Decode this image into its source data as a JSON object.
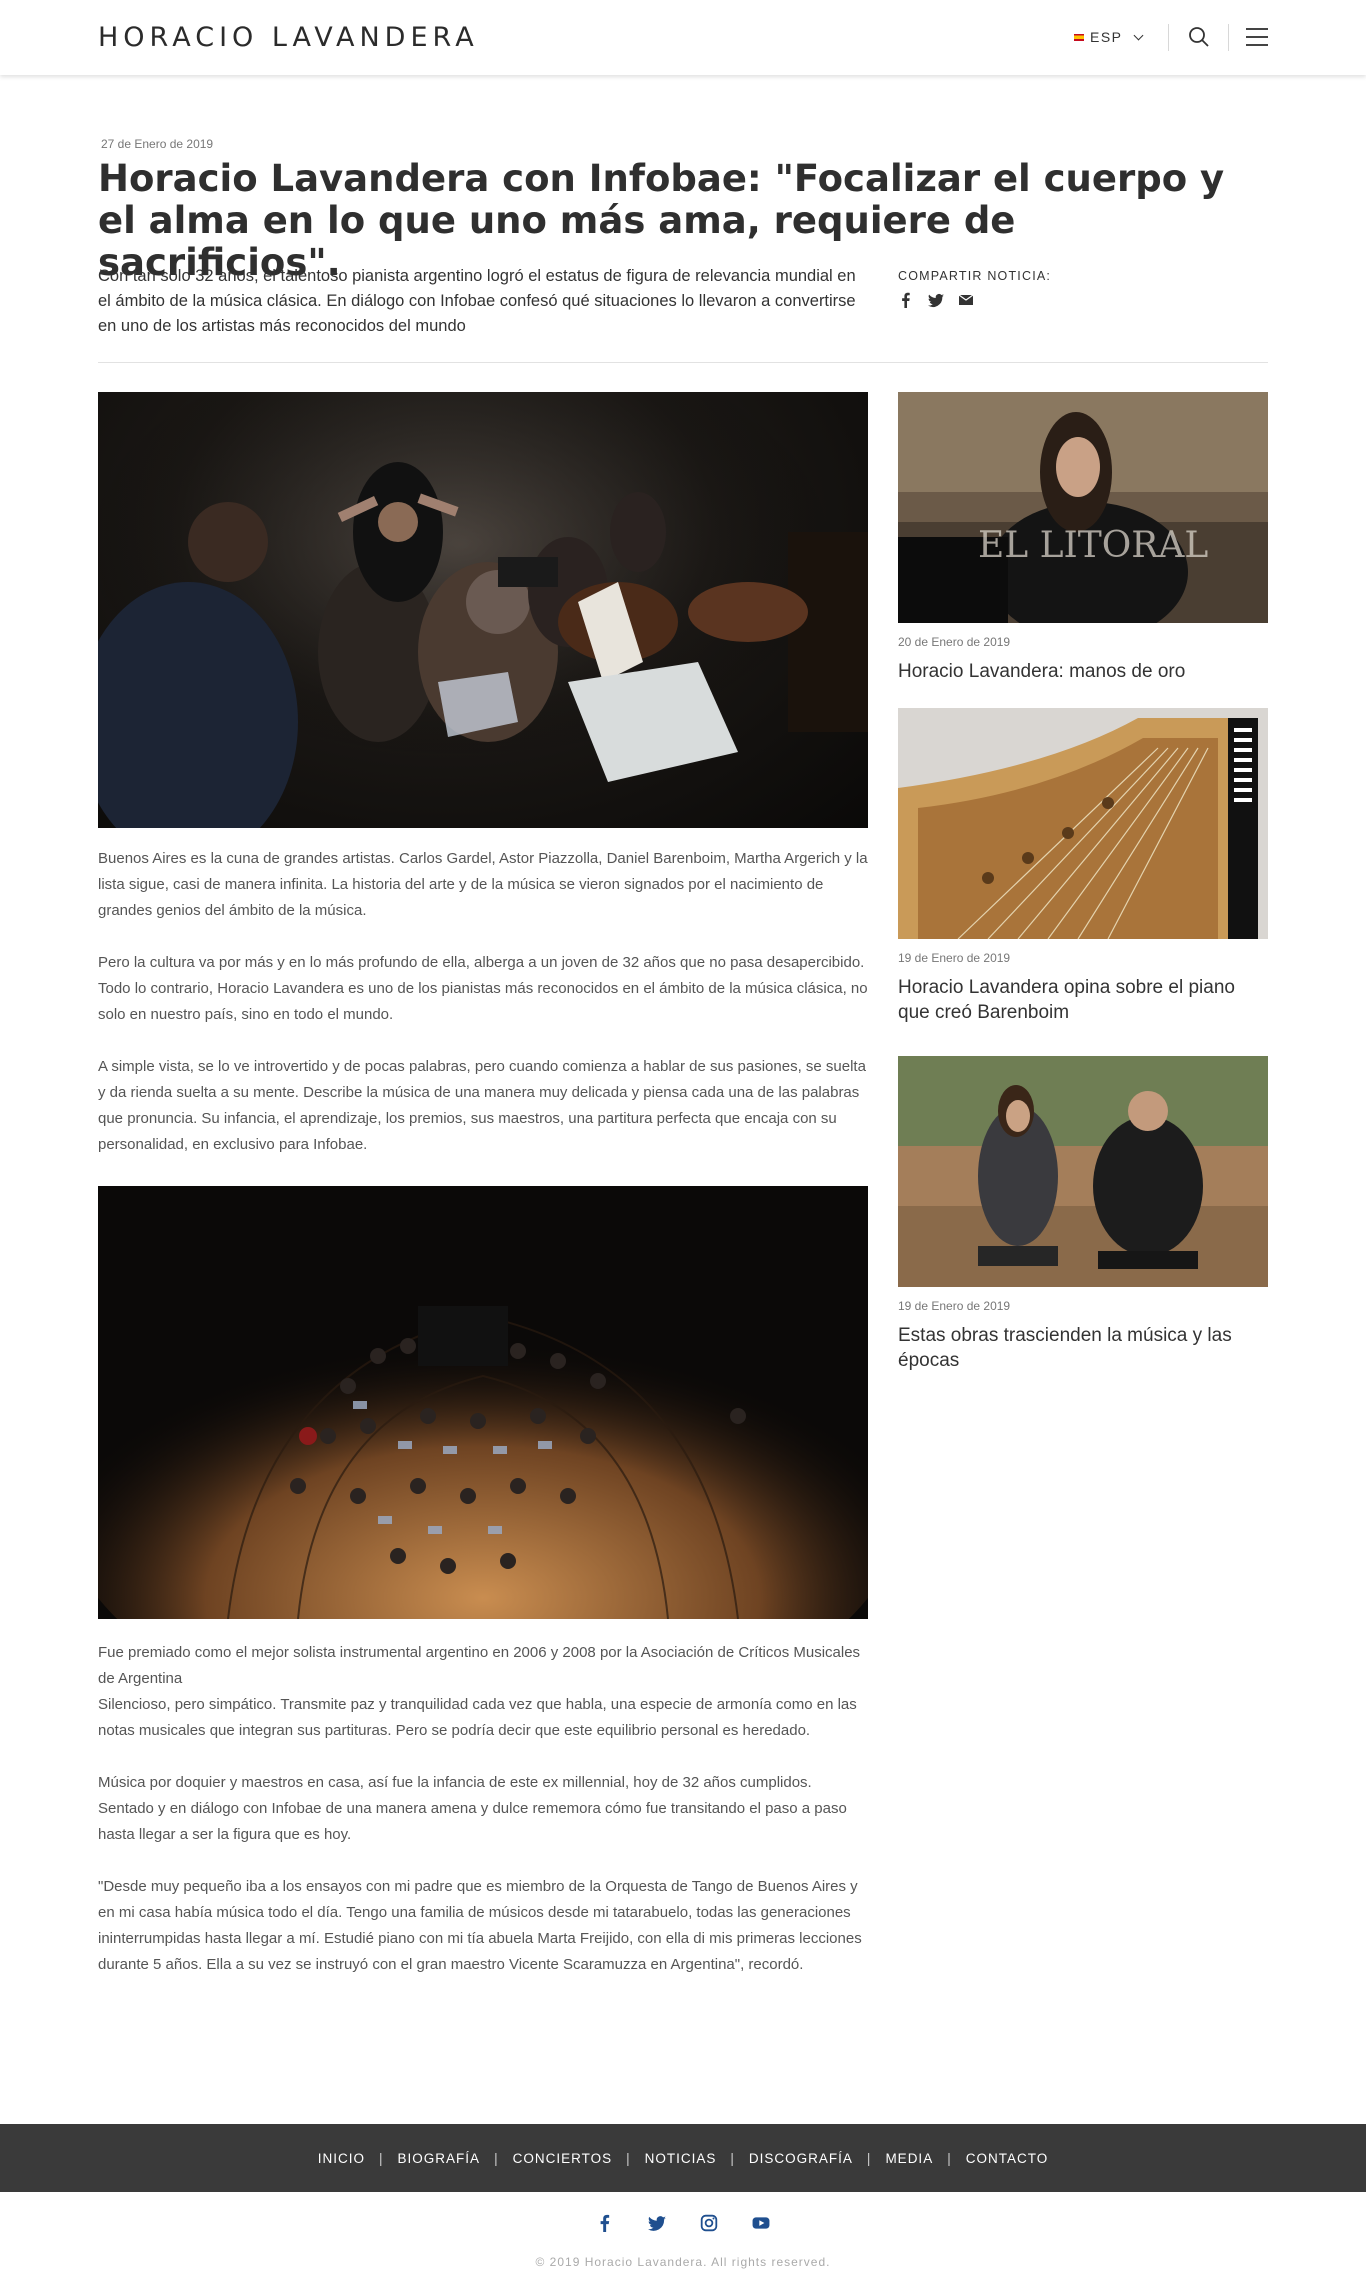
{
  "header": {
    "logo": "HORACIO LAVANDERA",
    "language": "ESP"
  },
  "article": {
    "date": "27 de Enero de 2019",
    "title": "Horacio Lavandera con Infobae: \"Focalizar el cuerpo y el alma en lo que uno más ama, requiere de sacrificios\".",
    "lead": "Con tan sólo 32 años, el talentoso pianista argentino logró el estatus de figura de relevancia mundial en el ámbito de la música clásica. En diálogo con Infobae confesó qué situaciones lo llevaron a convertirse en uno de los artistas más reconocidos del mundo",
    "share_label": "COMPARTIR NOTICIA:",
    "share_icons": [
      "facebook-icon",
      "twitter-icon",
      "email-icon"
    ],
    "paragraphs_a": [
      "Buenos Aires es la cuna de grandes artistas. Carlos Gardel, Astor Piazzolla, Daniel Barenboim, Martha Argerich y la lista sigue, casi de manera infinita. La historia del arte y de la música se vieron signados por el nacimiento de grandes genios del ámbito de la música.",
      "Pero la cultura va por más y en lo más profundo de ella, alberga a un joven de 32 años que no pasa desapercibido. Todo lo contrario, Horacio Lavandera es uno de los pianistas más reconocidos en el ámbito de la música clásica, no solo en nuestro país, sino en todo el mundo.",
      "A simple vista, se lo ve introvertido y de pocas palabras, pero cuando comienza a hablar de sus pasiones, se suelta y da rienda suelta a su mente. Describe la música de una manera muy delicada y piensa cada una de las palabras que pronuncia. Su infancia, el aprendizaje, los premios, sus maestros, una partitura perfecta que encaja con su personalidad, en exclusivo para Infobae."
    ],
    "paragraphs_b": [
      "Fue premiado como el mejor solista instrumental argentino en 2006 y 2008 por la Asociación de Críticos Musicales de Argentina",
      "Silencioso, pero simpático. Transmite paz y tranquilidad cada vez que habla, una especie de armonía como en las notas musicales que integran sus partituras. Pero se podría decir que este equilibrio personal es heredado.",
      "Música por doquier y maestros en casa, así fue la infancia de este ex millennial, hoy de 32 años cumplidos. Sentado y en diálogo con Infobae de una manera amena y dulce rememora cómo fue transitando el paso a paso hasta llegar a ser la figura que es hoy.",
      "\"Desde muy pequeño iba a los ensayos con mi padre que es miembro de la Orquesta de Tango de Buenos Aires y en mi casa había música todo el día. Tengo una familia de músicos desde mi tatarabuelo, todas las generaciones ininterrumpidas hasta llegar a mí. Estudié piano con mi tía abuela Marta Freijido, con ella di mis primeras lecciones durante 5 años. Ella a su vez se instruyó con el gran maestro Vicente Scaramuzza en Argentina\", recordó."
    ]
  },
  "sidebar": {
    "items": [
      {
        "date": "20 de Enero de 2019",
        "title": "Horacio Lavandera: manos de oro",
        "watermark": "EL LITORAL"
      },
      {
        "date": "19 de Enero de 2019",
        "title": "Horacio Lavandera opina sobre el piano que creó Barenboim"
      },
      {
        "date": "19 de Enero de 2019",
        "title": "Estas obras trascienden la música y las épocas"
      }
    ]
  },
  "footer": {
    "nav": [
      "INICIO",
      "BIOGRAFÍA",
      "CONCIERTOS",
      "NOTICIAS",
      "DISCOGRAFÍA",
      "MEDIA",
      "CONTACTO"
    ],
    "social_icons": [
      "facebook-icon",
      "twitter-icon",
      "instagram-icon",
      "youtube-icon"
    ],
    "social_color": "#1f4f8f",
    "copyright": "© 2019 Horacio Lavandera. All rights reserved."
  }
}
